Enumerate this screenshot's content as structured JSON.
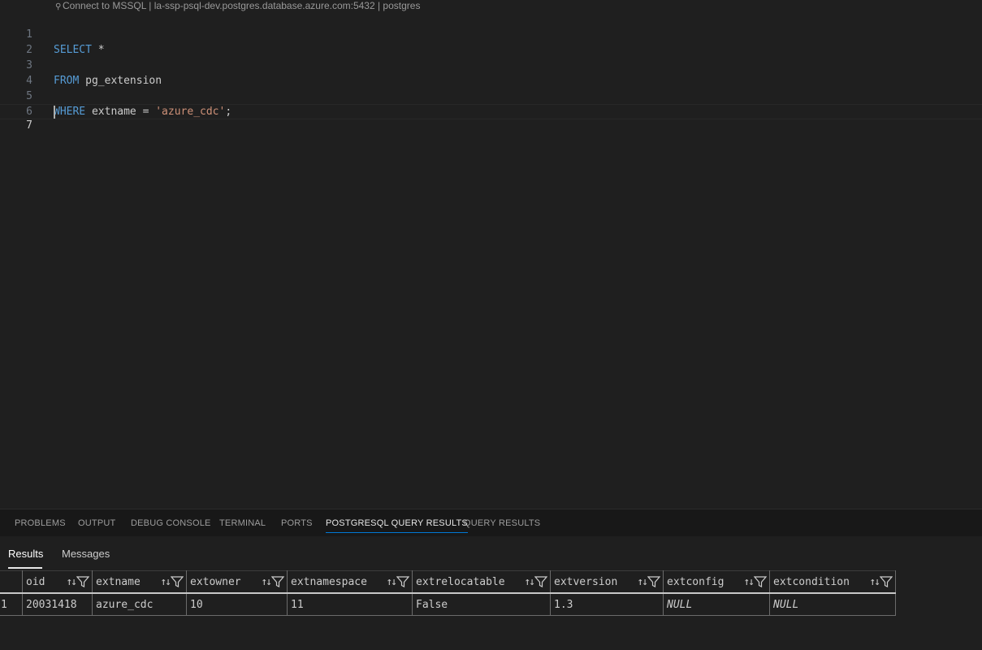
{
  "editor": {
    "codelens": "Connect to MSSQL | la-ssp-psql-dev.postgres.database.azure.com:5432 | postgres",
    "lines": [
      {
        "num": "1",
        "kw": "SELECT",
        "rest": " *",
        "str": "",
        "tail": ""
      },
      {
        "num": "2",
        "kw": "",
        "rest": "",
        "str": "",
        "tail": ""
      },
      {
        "num": "3",
        "kw": "FROM",
        "rest": " pg_extension",
        "str": "",
        "tail": ""
      },
      {
        "num": "4",
        "kw": "",
        "rest": "",
        "str": "",
        "tail": ""
      },
      {
        "num": "5",
        "kw": "WHERE",
        "rest": " extname = ",
        "str": "'azure_cdc'",
        "tail": ";"
      },
      {
        "num": "6",
        "kw": "",
        "rest": "",
        "str": "",
        "tail": ""
      },
      {
        "num": "7",
        "kw": "",
        "rest": "",
        "str": "",
        "tail": ""
      }
    ]
  },
  "panel": {
    "tabs": [
      "PROBLEMS",
      "OUTPUT",
      "DEBUG CONSOLE",
      "TERMINAL",
      "PORTS",
      "POSTGRESQL QUERY RESULTS",
      "QUERY RESULTS"
    ],
    "active_tab": "POSTGRESQL QUERY RESULTS",
    "sub_tabs": [
      "Results",
      "Messages"
    ]
  },
  "results": {
    "columns": [
      "oid",
      "extname",
      "extowner",
      "extnamespace",
      "extrelocatable",
      "extversion",
      "extconfig",
      "extcondition"
    ],
    "rows": [
      [
        "1",
        "20031418",
        "azure_cdc",
        "10",
        "11",
        "False",
        "1.3",
        "NULL",
        "NULL"
      ]
    ]
  },
  "colors": {
    "keyword": "#569cd6",
    "string": "#ce9178",
    "active_tab_underline": "#0078d4"
  }
}
